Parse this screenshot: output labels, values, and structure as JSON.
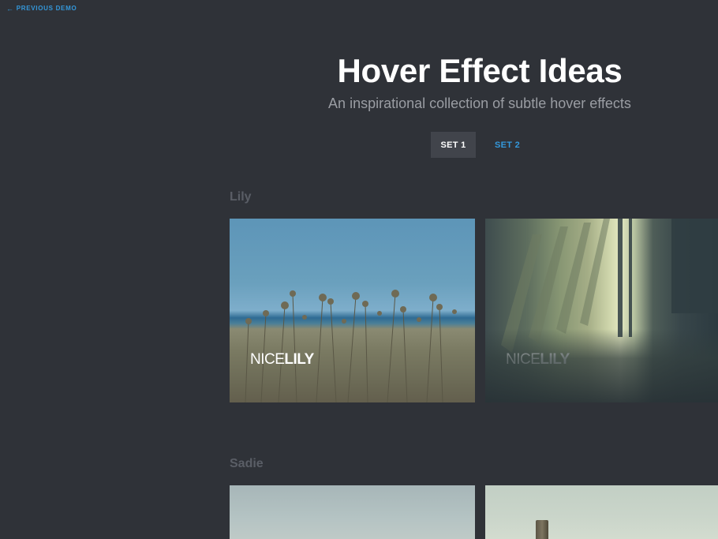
{
  "nav": {
    "previous_demo_label": "PREVIOUS DEMO"
  },
  "header": {
    "title": "Hover Effect Ideas",
    "subtitle": "An inspirational collection of subtle hover effects"
  },
  "tabs": [
    {
      "label": "SET 1",
      "active": true
    },
    {
      "label": "SET 2",
      "active": false
    }
  ],
  "sections": [
    {
      "title": "Lily",
      "items": [
        {
          "caption_light": "NICE",
          "caption_bold": "LILY",
          "image": "field-of-flowers-by-sea"
        },
        {
          "caption_light": "NICE",
          "caption_bold": "LILY",
          "image": "interior-wall-with-windows"
        }
      ]
    },
    {
      "title": "Sadie",
      "items": [
        {
          "image": "pale-sky-landscape"
        },
        {
          "image": "wooden-post-landscape"
        }
      ]
    }
  ],
  "colors": {
    "background": "#2f3238",
    "accent": "#3498db",
    "active_tab": "#41444b",
    "section_title": "#5a5e66",
    "subtitle": "#9a9da3"
  }
}
